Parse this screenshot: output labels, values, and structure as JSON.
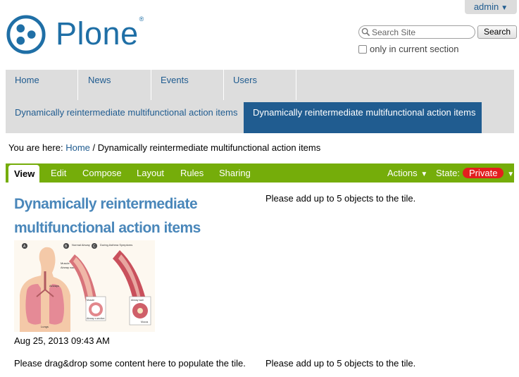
{
  "user_menu": {
    "label": "admin"
  },
  "logo": {
    "text": "Plone",
    "registered": "®"
  },
  "search": {
    "placeholder": "Search Site",
    "button": "Search",
    "only_current_label": "only in current section"
  },
  "global_nav": {
    "tabs": [
      {
        "label": "Home"
      },
      {
        "label": "News"
      },
      {
        "label": "Events"
      },
      {
        "label": "Users"
      }
    ],
    "sub_items": [
      {
        "label": "Dynamically reintermediate multifunctional action items",
        "active": false
      },
      {
        "label": "Dynamically reintermediate multifunctional action items",
        "active": true
      }
    ]
  },
  "breadcrumb": {
    "prefix": "You are here:",
    "home": "Home",
    "separator": "/",
    "current": "Dynamically reintermediate multifunctional action items"
  },
  "edit_bar": {
    "tabs": [
      {
        "label": "View",
        "active": true
      },
      {
        "label": "Edit"
      },
      {
        "label": "Compose"
      },
      {
        "label": "Layout"
      },
      {
        "label": "Rules"
      },
      {
        "label": "Sharing"
      }
    ],
    "actions_label": "Actions",
    "state_label": "State:",
    "state_value": "Private"
  },
  "content": {
    "title": "Dynamically reintermediate multifunctional action items",
    "date": "Aug 25, 2013 09:43 AM",
    "tile_msg_1": "Please add up to 5 objects to the tile.",
    "tile_msg_2": "Please drag&drop some content here to populate the tile.",
    "tile_msg_3": "Please add up to 5 objects to the tile.",
    "image_labels": [
      "A",
      "B",
      "C",
      "Normal Airway",
      "During Asthma Symptoms",
      "Muscle",
      "Airway wall",
      "Airways",
      "Lungs",
      "Muscle",
      "Airway wall",
      "Airway x-section",
      "Mucus"
    ]
  },
  "colors": {
    "brand_blue": "#1f6fa6",
    "link_blue": "#205c90",
    "editbar_green": "#75ad0a",
    "private_red": "#e31e1e",
    "title_blue": "#4a87ba"
  }
}
